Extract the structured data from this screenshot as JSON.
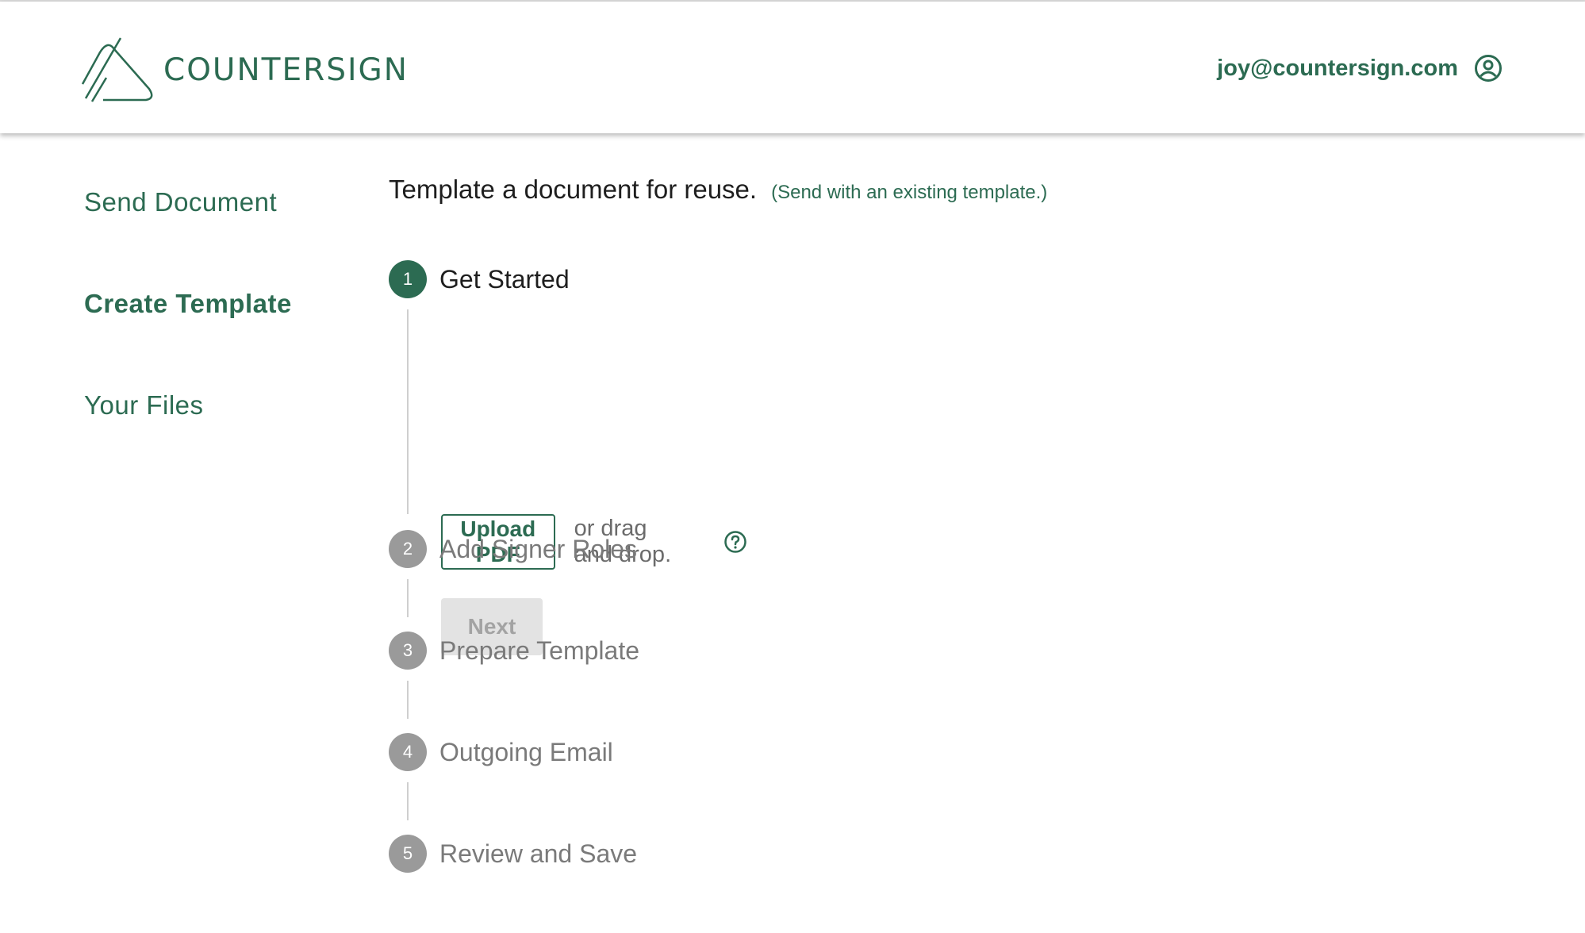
{
  "brand": {
    "name": "COUNTERSIGN",
    "color": "#2c6b52"
  },
  "user": {
    "email": "joy@countersign.com",
    "icon": "account-circle-icon"
  },
  "sidebar": {
    "items": [
      {
        "label": "Send Document",
        "active": false
      },
      {
        "label": "Create Template",
        "active": true
      },
      {
        "label": "Your Files",
        "active": false
      }
    ]
  },
  "main": {
    "title": "Template a document for reuse.",
    "alt_link": "(Send with an existing template.)",
    "upload_button": "Upload PDF",
    "drag_text": "or drag and drop.",
    "help_icon": "question-circle-icon",
    "next_button": "Next",
    "steps": [
      {
        "number": "1",
        "label": "Get Started",
        "active": true
      },
      {
        "number": "2",
        "label": "Add Signer Roles",
        "active": false
      },
      {
        "number": "3",
        "label": "Prepare Template",
        "active": false
      },
      {
        "number": "4",
        "label": "Outgoing Email",
        "active": false
      },
      {
        "number": "5",
        "label": "Review and Save",
        "active": false
      }
    ]
  }
}
